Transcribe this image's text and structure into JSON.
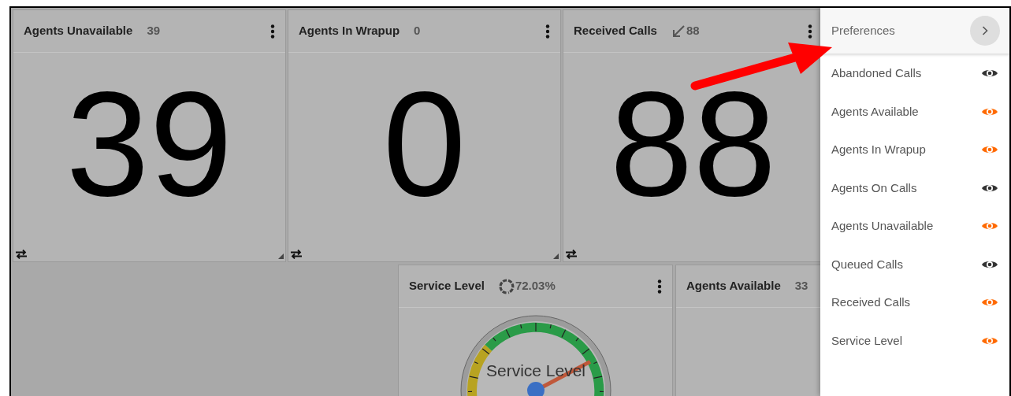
{
  "top_row": [
    {
      "kind": "number",
      "title": "Agents Unavailable",
      "count": "39",
      "value": "39"
    },
    {
      "kind": "number",
      "title": "Agents In Wrapup",
      "count": "0",
      "value": "0"
    },
    {
      "kind": "number",
      "title": "Received Calls",
      "count_icon": {
        "kind": "incoming"
      },
      "count": "88",
      "value": "88"
    }
  ],
  "bottom_row": [
    {
      "kind": "gauge",
      "title": "Service Level",
      "count_icon": {
        "kind": "ring"
      },
      "count": "72.03%",
      "gauge_label": "Service Level"
    },
    {
      "kind": "number",
      "title": "Agents Available",
      "count": "33"
    }
  ],
  "preferences": {
    "title": "Preferences",
    "items": [
      {
        "label": "Abandoned Calls",
        "shown": false
      },
      {
        "label": "Agents Available",
        "shown": true
      },
      {
        "label": "Agents In Wrapup",
        "shown": true
      },
      {
        "label": "Agents On Calls",
        "shown": false
      },
      {
        "label": "Agents Unavailable",
        "shown": true
      },
      {
        "label": "Queued Calls",
        "shown": false
      },
      {
        "label": "Received Calls",
        "shown": true
      },
      {
        "label": "Service Level",
        "shown": true
      }
    ]
  }
}
